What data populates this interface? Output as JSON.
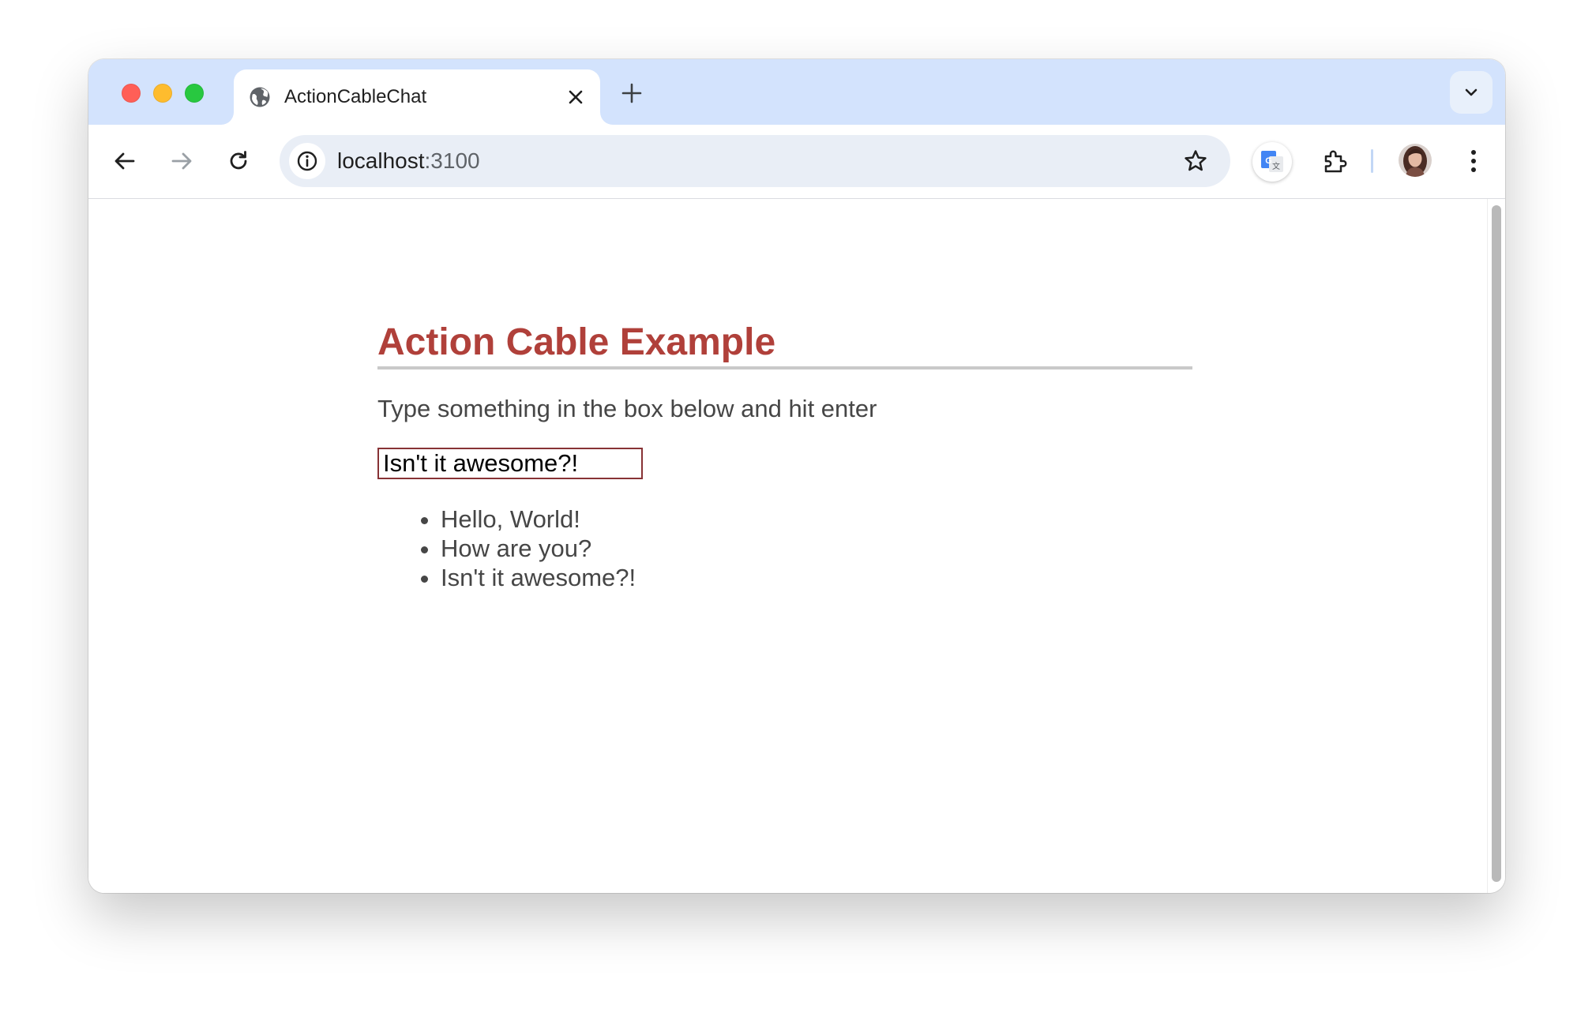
{
  "browser": {
    "tab": {
      "title": "ActionCableChat"
    },
    "address_bar": {
      "host": "localhost",
      "port": ":3100"
    },
    "colors": {
      "tabstrip": "#d3e3fd",
      "close": "#ff5f57",
      "minimize": "#febc2e",
      "maximize": "#28c840"
    }
  },
  "page": {
    "heading": "Action Cable Example",
    "instructions": "Type something in the box below and hit enter",
    "input": {
      "value": "Isn't it awesome?!"
    },
    "messages": [
      {
        "text": "Hello, World!"
      },
      {
        "text": "How are you?"
      },
      {
        "text": "Isn't it awesome?!"
      }
    ],
    "colors": {
      "heading": "#b0403a",
      "input_border": "#873235",
      "text": "#464646"
    }
  }
}
